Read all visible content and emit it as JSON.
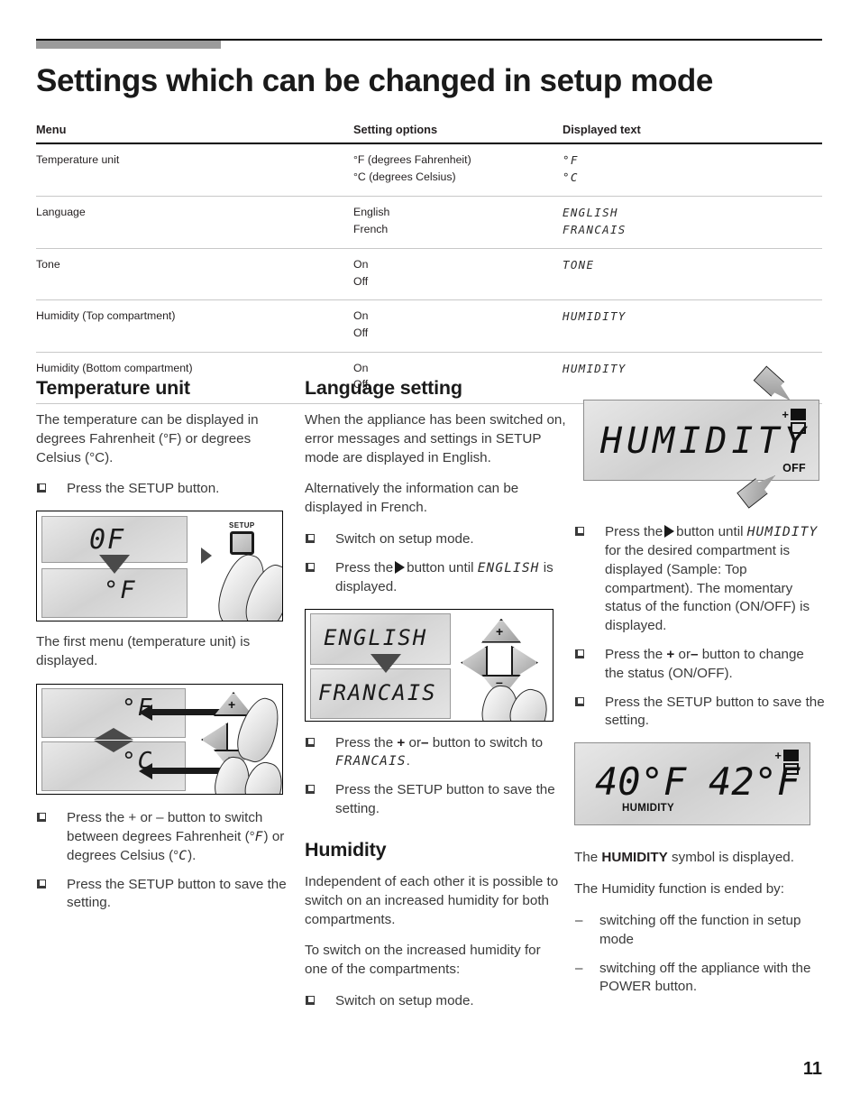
{
  "page": {
    "title": "Settings which can be changed in setup mode",
    "number": "11"
  },
  "table": {
    "headers": [
      "Menu",
      "Setting options",
      "Displayed text"
    ],
    "rows": [
      {
        "menu": "Temperature unit",
        "options": [
          "°F (degrees Fahrenheit)",
          "°C (degrees Celsius)"
        ],
        "displayed": [
          "°F",
          "°C"
        ]
      },
      {
        "menu": "Language",
        "options": [
          "English",
          "French"
        ],
        "displayed": [
          "ENGLISH",
          "FRANCAIS"
        ]
      },
      {
        "menu": "Tone",
        "options": [
          "On",
          "Off"
        ],
        "displayed": [
          "TONE",
          ""
        ]
      },
      {
        "menu": "Humidity (Top compartment)",
        "options": [
          "On",
          "Off"
        ],
        "displayed": [
          "HUMIDITY",
          ""
        ]
      },
      {
        "menu": "Humidity (Bottom compartment)",
        "options": [
          "On",
          "Off"
        ],
        "displayed": [
          "HUMIDITY",
          ""
        ]
      }
    ]
  },
  "temperature_unit": {
    "heading": "Temperature unit",
    "intro": "The temperature can be displayed in degrees Fahrenheit (°F) or degrees Celsius (°C).",
    "step1": "Press the SETUP button.",
    "fig1": {
      "display_top": "0F",
      "display_bottom": "°F",
      "key_label": "SETUP"
    },
    "after_fig1": "The first menu (temperature unit) is displayed.",
    "fig2": {
      "display_top": "°F",
      "display_bottom": "°C",
      "plus": "+",
      "minus": "–"
    },
    "step2_a": "Press the + or – button to switch between degrees Fahrenheit (°",
    "step2_f": "F",
    "step2_b": ") or degrees Celsius (°",
    "step2_c": "C",
    "step2_d": ").",
    "step3": "Press the SETUP button to save the setting."
  },
  "language": {
    "heading": "Language setting",
    "para1": "When the appliance has been switched on, error messages and settings in SETUP mode are displayed in English.",
    "para2": "Alternatively the information can be displayed in French.",
    "step1": "Switch on setup mode.",
    "step2_a": "Press the",
    "step2_b": "button until",
    "step2_lcd": "ENGLISH",
    "step2_c": "is displayed.",
    "fig3": {
      "display_top": "ENGLISH",
      "display_bottom": "FRANCAIS",
      "plus": "+",
      "minus": "–"
    },
    "step3_a": "Press the",
    "step3_plus": "+",
    "step3_or": "or",
    "step3_minus": "–",
    "step3_b": "button to switch to",
    "step3_lcd": "FRANCAIS",
    "step3_c": ".",
    "step4": "Press the SETUP button to save the setting."
  },
  "humidity": {
    "heading": "Humidity",
    "para1": "Independent of each other it is possible to switch on an increased humidity for both compartments.",
    "para2": "To switch on the increased humidity for one of the compartments:",
    "step1": "Switch on setup mode."
  },
  "right": {
    "fig4": {
      "display_text": "HUMIDITY",
      "status": "OFF"
    },
    "step1_a": "Press the",
    "step1_b": "button until",
    "step1_lcd": "HUMIDITY",
    "step1_c": "for the desired compartment is displayed (Sample: Top compartment). The momentary status of the function (ON/OFF) is displayed.",
    "step2_a": "Press the",
    "step2_plus": "+",
    "step2_or": "or",
    "step2_minus": "–",
    "step2_b": "button to change the status (ON/OFF).",
    "step3": "Press the SETUP button to save the setting.",
    "fig5": {
      "temp_left": "40°F",
      "temp_right": "42°F",
      "label": "HUMIDITY"
    },
    "note_a": "The",
    "note_bold": "HUMIDITY",
    "note_b": "symbol is displayed.",
    "note2": "The Humidity function is ended by:",
    "dash1": "switching off the function in setup mode",
    "dash2": "switching off the appliance with the POWER button."
  }
}
